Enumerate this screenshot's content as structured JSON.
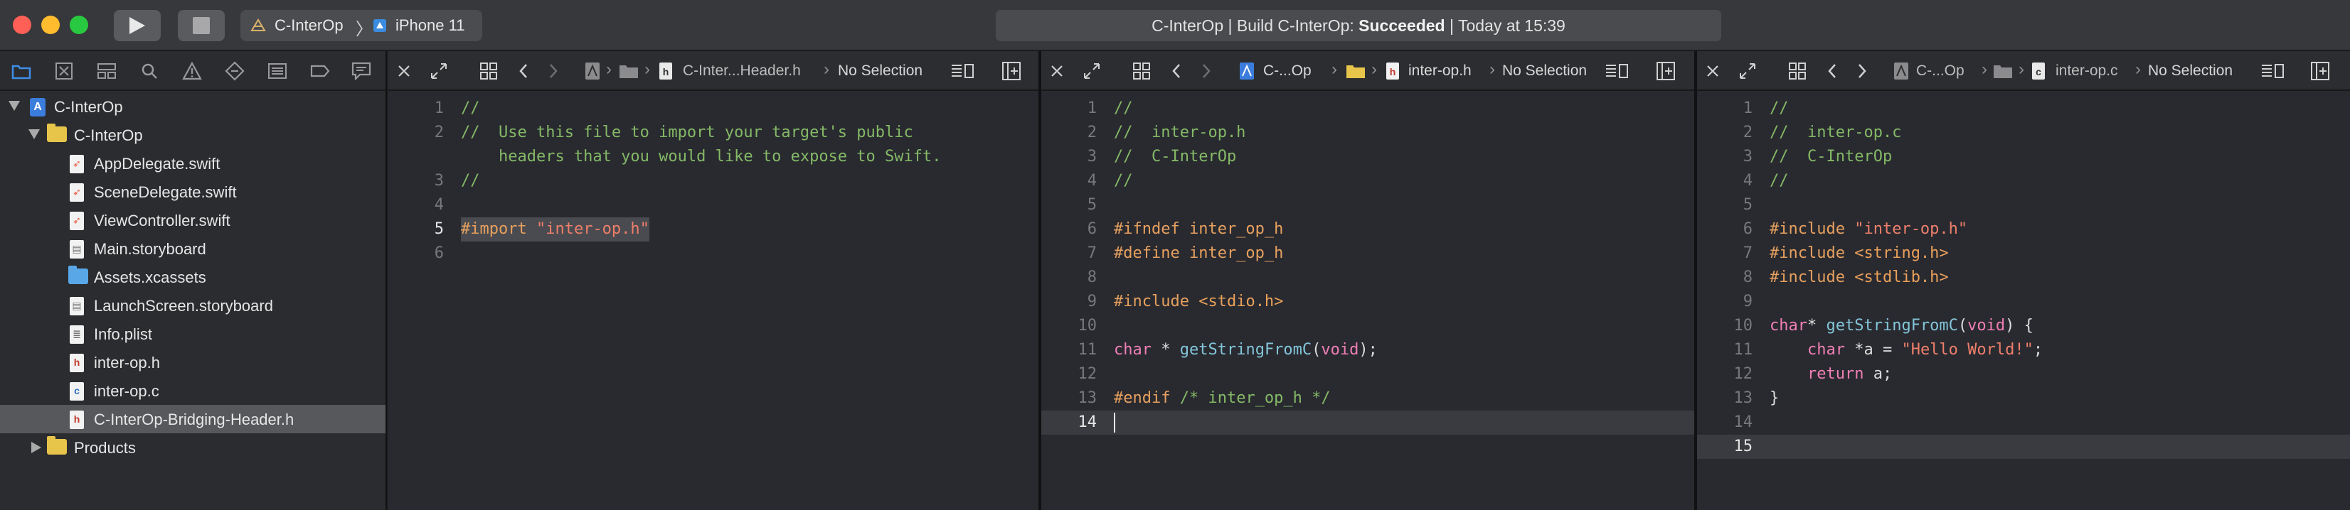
{
  "toolbar": {
    "scheme_name": "C-InterOp",
    "device_name": "iPhone 11",
    "activity_prefix": "C-InterOp | Build C-InterOp: ",
    "activity_status": "Succeeded",
    "activity_suffix": " | Today at 15:39"
  },
  "navigator": {
    "items": [
      {
        "label": "C-InterOp"
      },
      {
        "label": "C-InterOp"
      },
      {
        "label": "AppDelegate.swift"
      },
      {
        "label": "SceneDelegate.swift"
      },
      {
        "label": "ViewController.swift"
      },
      {
        "label": "Main.storyboard"
      },
      {
        "label": "Assets.xcassets"
      },
      {
        "label": "LaunchScreen.storyboard"
      },
      {
        "label": "Info.plist"
      },
      {
        "label": "inter-op.h"
      },
      {
        "label": "inter-op.c"
      },
      {
        "label": "C-InterOp-Bridging-Header.h"
      },
      {
        "label": "Products"
      }
    ],
    "file_glyphs": {
      "h": "h",
      "c": "c"
    }
  },
  "editor1": {
    "jump_file": "C-Inter...Header.h",
    "jump_selection": "No Selection",
    "lines": [
      {
        "n": "1",
        "t": "//"
      },
      {
        "n": "2",
        "t": "//  Use this file to import your target's public"
      },
      {
        "n": "",
        "t": "    headers that you would like to expose to Swift."
      },
      {
        "n": "3",
        "t": "//"
      },
      {
        "n": "4",
        "t": ""
      },
      {
        "n": "5",
        "a": "#import",
        "b": " ",
        "c": "\"inter-op.h\""
      },
      {
        "n": "6",
        "t": ""
      }
    ]
  },
  "editor2": {
    "jump_project": "C-...Op",
    "jump_file": "inter-op.h",
    "jump_selection": "No Selection",
    "lines": [
      {
        "n": "1",
        "t": "//"
      },
      {
        "n": "2",
        "t": "//  inter-op.h"
      },
      {
        "n": "3",
        "t": "//  C-InterOp"
      },
      {
        "n": "4",
        "t": "//"
      },
      {
        "n": "5",
        "t": ""
      },
      {
        "n": "6",
        "t": "#ifndef inter_op_h"
      },
      {
        "n": "7",
        "t": "#define inter_op_h"
      },
      {
        "n": "8",
        "t": ""
      },
      {
        "n": "9",
        "a": "#include",
        "b": " ",
        "c": "<stdio.h>"
      },
      {
        "n": "10",
        "t": ""
      },
      {
        "n": "11",
        "k1": "char",
        "m1": " * ",
        "f1": "getStringFromC",
        "m2": "(",
        "k2": "void",
        "m3": ");"
      },
      {
        "n": "12",
        "t": ""
      },
      {
        "n": "13",
        "a": "#endif",
        "c": " /* inter_op_h */"
      },
      {
        "n": "14",
        "t": ""
      }
    ]
  },
  "editor3": {
    "jump_project": "C-...Op",
    "jump_file": "inter-op.c",
    "jump_selection": "No Selection",
    "lines": [
      {
        "n": "1",
        "t": "//"
      },
      {
        "n": "2",
        "t": "//  inter-op.c"
      },
      {
        "n": "3",
        "t": "//  C-InterOp"
      },
      {
        "n": "4",
        "t": "//"
      },
      {
        "n": "5",
        "t": ""
      },
      {
        "n": "6",
        "a": "#include",
        "b": " ",
        "c": "\"inter-op.h\""
      },
      {
        "n": "7",
        "a": "#include",
        "b": " ",
        "c": "<string.h>"
      },
      {
        "n": "8",
        "a": "#include",
        "b": " ",
        "c": "<stdlib.h>"
      },
      {
        "n": "9",
        "t": ""
      },
      {
        "n": "10",
        "k1": "char",
        "m1": "* ",
        "f1": "getStringFromC",
        "m2": "(",
        "k2": "void",
        "m3": ") {"
      },
      {
        "n": "11",
        "i": "    ",
        "k1": "char",
        "m1": " *a = ",
        "s": "\"Hello World!\"",
        "m3": ";"
      },
      {
        "n": "12",
        "i": "    ",
        "k1": "return",
        "m3": " a;"
      },
      {
        "n": "13",
        "t": "}"
      },
      {
        "n": "14",
        "t": ""
      },
      {
        "n": "15",
        "t": ""
      }
    ]
  }
}
